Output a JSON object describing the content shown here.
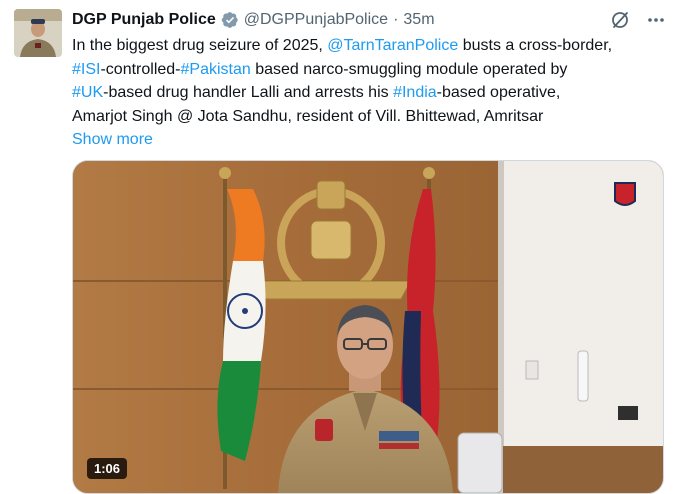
{
  "author": {
    "name": "DGP Punjab Police",
    "handle": "@DGPPunjabPolice",
    "separator": "·",
    "time": "35m"
  },
  "tweet": {
    "lines": [
      [
        {
          "text": "In the biggest drug seizure of 2025, ",
          "kind": "text"
        },
        {
          "text": "@TarnTaranPolice",
          "kind": "link"
        },
        {
          "text": " busts a cross-border,",
          "kind": "text"
        }
      ],
      [
        {
          "text": "#ISI",
          "kind": "link"
        },
        {
          "text": "-controlled-",
          "kind": "text"
        },
        {
          "text": "#Pakistan",
          "kind": "link"
        },
        {
          "text": " based narco-smuggling module operated by",
          "kind": "text"
        }
      ],
      [
        {
          "text": "#UK",
          "kind": "link"
        },
        {
          "text": "-based drug handler Lalli and arrests his ",
          "kind": "text"
        },
        {
          "text": "#India",
          "kind": "link"
        },
        {
          "text": "-based operative,",
          "kind": "text"
        }
      ],
      [
        {
          "text": "Amarjot Singh @ Jota Sandhu, resident of Vill. Bhittewad, Amritsar",
          "kind": "text"
        }
      ]
    ],
    "show_more": "Show more"
  },
  "media": {
    "duration": "1:06"
  },
  "colors": {
    "link": "#1d9bf0",
    "secondary_text": "#536471",
    "verified": "#829aab"
  },
  "icons": [
    "verified-badge-icon",
    "grok-icon",
    "more-icon"
  ]
}
